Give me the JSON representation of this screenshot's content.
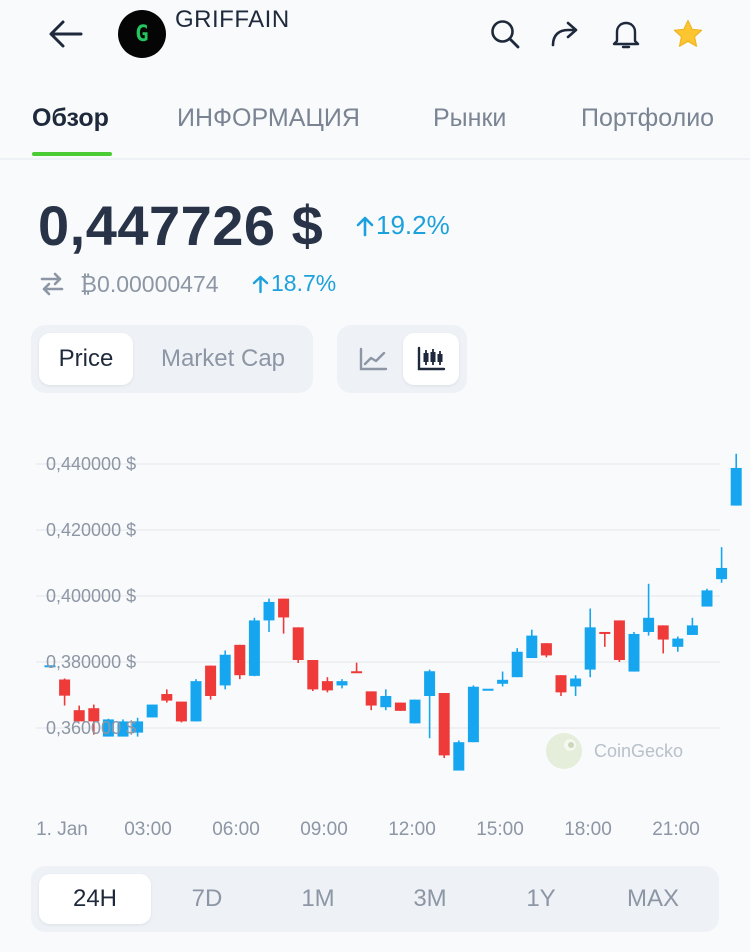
{
  "header": {
    "coin_name": "GRIFFAIN",
    "logo_letter": "G",
    "icons": [
      "back-arrow-icon",
      "search-icon",
      "share-icon",
      "bell-icon",
      "star-icon"
    ],
    "star_color": "#fcc531"
  },
  "tabs": [
    {
      "label": "Обзор",
      "active": true
    },
    {
      "label": "ИНФОРМАЦИЯ",
      "active": false
    },
    {
      "label": "Рынки",
      "active": false
    },
    {
      "label": "Портфолио",
      "active": false
    }
  ],
  "price": {
    "value": "0,447726 $",
    "change": "19.2%",
    "btc_value": "₿0.00000474",
    "btc_change": "18.7%",
    "up_color": "#1da1dd"
  },
  "toggles": {
    "metric": [
      {
        "label": "Price",
        "active": true
      },
      {
        "label": "Market Cap",
        "active": false
      }
    ],
    "chart_type": [
      {
        "icon": "line-chart-icon",
        "active": false
      },
      {
        "icon": "candlestick-chart-icon",
        "active": true
      }
    ]
  },
  "chart_data": {
    "type": "candlestick",
    "watermark": "CoinGecko",
    "y_ticks": [
      "0,440000 $",
      "0,420000 $",
      "0,400000 $",
      "0,380000 $",
      "0,360000 $"
    ],
    "y_values": [
      0.44,
      0.42,
      0.4,
      0.38,
      0.36
    ],
    "x_ticks": [
      "1. Jan",
      "03:00",
      "06:00",
      "09:00",
      "12:00",
      "15:00",
      "18:00",
      "21:00"
    ],
    "up_color": "#16a6ef",
    "down_color": "#ef3a3a",
    "candles": [
      {
        "o": 0.3785,
        "h": 0.3785,
        "l": 0.3785,
        "c": 0.379,
        "up": true
      },
      {
        "o": 0.3747,
        "h": 0.375,
        "l": 0.3668,
        "c": 0.3698,
        "up": false
      },
      {
        "o": 0.3654,
        "h": 0.3668,
        "l": 0.362,
        "c": 0.362,
        "up": false
      },
      {
        "o": 0.366,
        "h": 0.3671,
        "l": 0.358,
        "c": 0.362,
        "up": false
      },
      {
        "o": 0.3574,
        "h": 0.3628,
        "l": 0.3574,
        "c": 0.3626,
        "up": true
      },
      {
        "o": 0.3574,
        "h": 0.3626,
        "l": 0.3574,
        "c": 0.362,
        "up": true
      },
      {
        "o": 0.3586,
        "h": 0.3631,
        "l": 0.3574,
        "c": 0.362,
        "up": true
      },
      {
        "o": 0.3632,
        "h": 0.3671,
        "l": 0.3632,
        "c": 0.3671,
        "up": true
      },
      {
        "o": 0.3703,
        "h": 0.3717,
        "l": 0.3677,
        "c": 0.3683,
        "up": false
      },
      {
        "o": 0.368,
        "h": 0.368,
        "l": 0.3617,
        "c": 0.362,
        "up": false
      },
      {
        "o": 0.362,
        "h": 0.3748,
        "l": 0.362,
        "c": 0.3742,
        "up": true
      },
      {
        "o": 0.3789,
        "h": 0.3789,
        "l": 0.3686,
        "c": 0.3697,
        "up": false
      },
      {
        "o": 0.3729,
        "h": 0.3835,
        "l": 0.3717,
        "c": 0.3822,
        "up": true
      },
      {
        "o": 0.3852,
        "h": 0.3852,
        "l": 0.3748,
        "c": 0.376,
        "up": false
      },
      {
        "o": 0.3758,
        "h": 0.3934,
        "l": 0.3757,
        "c": 0.3926,
        "up": true
      },
      {
        "o": 0.3926,
        "h": 0.3992,
        "l": 0.3891,
        "c": 0.3982,
        "up": true
      },
      {
        "o": 0.3992,
        "h": 0.3992,
        "l": 0.3886,
        "c": 0.3935,
        "up": false
      },
      {
        "o": 0.3905,
        "h": 0.3905,
        "l": 0.3797,
        "c": 0.3806,
        "up": false
      },
      {
        "o": 0.3806,
        "h": 0.3806,
        "l": 0.3712,
        "c": 0.3717,
        "up": false
      },
      {
        "o": 0.3742,
        "h": 0.3754,
        "l": 0.3708,
        "c": 0.3714,
        "up": false
      },
      {
        "o": 0.3729,
        "h": 0.3748,
        "l": 0.372,
        "c": 0.3742,
        "up": true
      },
      {
        "o": 0.3771,
        "h": 0.3798,
        "l": 0.3771,
        "c": 0.3772,
        "up": false
      },
      {
        "o": 0.3711,
        "h": 0.3711,
        "l": 0.3654,
        "c": 0.3668,
        "up": false
      },
      {
        "o": 0.3663,
        "h": 0.3717,
        "l": 0.3654,
        "c": 0.3697,
        "up": true
      },
      {
        "o": 0.3677,
        "h": 0.3677,
        "l": 0.3652,
        "c": 0.3652,
        "up": false
      },
      {
        "o": 0.3614,
        "h": 0.3686,
        "l": 0.3614,
        "c": 0.3686,
        "up": true
      },
      {
        "o": 0.3697,
        "h": 0.3777,
        "l": 0.3569,
        "c": 0.3772,
        "up": true
      },
      {
        "o": 0.3706,
        "h": 0.3706,
        "l": 0.3509,
        "c": 0.3517,
        "up": false
      },
      {
        "o": 0.3471,
        "h": 0.3562,
        "l": 0.3471,
        "c": 0.3557,
        "up": true
      },
      {
        "o": 0.3557,
        "h": 0.3729,
        "l": 0.3557,
        "c": 0.3725,
        "up": true
      },
      {
        "o": 0.3717,
        "h": 0.3717,
        "l": 0.3717,
        "c": 0.3719,
        "up": true
      },
      {
        "o": 0.3734,
        "h": 0.3771,
        "l": 0.3726,
        "c": 0.3746,
        "up": true
      },
      {
        "o": 0.3754,
        "h": 0.3842,
        "l": 0.3754,
        "c": 0.3831,
        "up": true
      },
      {
        "o": 0.3812,
        "h": 0.3898,
        "l": 0.3812,
        "c": 0.388,
        "up": true
      },
      {
        "o": 0.3857,
        "h": 0.3857,
        "l": 0.3814,
        "c": 0.382,
        "up": false
      },
      {
        "o": 0.376,
        "h": 0.376,
        "l": 0.3697,
        "c": 0.3708,
        "up": false
      },
      {
        "o": 0.3726,
        "h": 0.376,
        "l": 0.3697,
        "c": 0.375,
        "up": true
      },
      {
        "o": 0.3777,
        "h": 0.3962,
        "l": 0.3754,
        "c": 0.3905,
        "up": true
      },
      {
        "o": 0.3891,
        "h": 0.3891,
        "l": 0.3846,
        "c": 0.3891,
        "up": false
      },
      {
        "o": 0.3926,
        "h": 0.3926,
        "l": 0.38,
        "c": 0.3806,
        "up": false
      },
      {
        "o": 0.3771,
        "h": 0.3891,
        "l": 0.3771,
        "c": 0.3885,
        "up": true
      },
      {
        "o": 0.3891,
        "h": 0.4037,
        "l": 0.388,
        "c": 0.3934,
        "up": true
      },
      {
        "o": 0.3911,
        "h": 0.3911,
        "l": 0.3826,
        "c": 0.3868,
        "up": false
      },
      {
        "o": 0.3846,
        "h": 0.3877,
        "l": 0.3831,
        "c": 0.3871,
        "up": true
      },
      {
        "o": 0.3882,
        "h": 0.3934,
        "l": 0.3882,
        "c": 0.3911,
        "up": true
      },
      {
        "o": 0.3968,
        "h": 0.4022,
        "l": 0.3968,
        "c": 0.4017,
        "up": true
      },
      {
        "o": 0.4051,
        "h": 0.4148,
        "l": 0.404,
        "c": 0.4085,
        "up": true
      },
      {
        "o": 0.4274,
        "h": 0.4431,
        "l": 0.4274,
        "c": 0.4388,
        "up": true
      }
    ]
  },
  "ranges": [
    {
      "label": "24H",
      "active": true
    },
    {
      "label": "7D",
      "active": false
    },
    {
      "label": "1M",
      "active": false
    },
    {
      "label": "3M",
      "active": false
    },
    {
      "label": "1Y",
      "active": false
    },
    {
      "label": "MAX",
      "active": false
    }
  ]
}
